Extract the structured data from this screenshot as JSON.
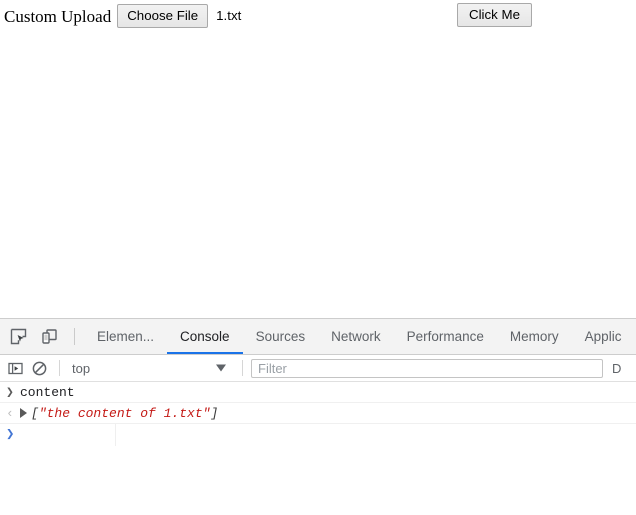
{
  "page": {
    "upload_label": "Custom Upload",
    "choose_file_button": "Choose File",
    "file_name": "1.txt",
    "click_me_button": "Click Me"
  },
  "devtools": {
    "icons": {
      "inspect": "inspect-element-icon",
      "device": "device-toolbar-icon",
      "sidebar": "console-sidebar-icon",
      "clear": "clear-console-icon"
    },
    "tabs": [
      {
        "label": "Elemen...",
        "active": false
      },
      {
        "label": "Console",
        "active": true
      },
      {
        "label": "Sources",
        "active": false
      },
      {
        "label": "Network",
        "active": false
      },
      {
        "label": "Performance",
        "active": false
      },
      {
        "label": "Memory",
        "active": false
      },
      {
        "label": "Applic",
        "active": false
      }
    ],
    "filterbar": {
      "context": "top",
      "filter_value": "",
      "filter_placeholder": "Filter",
      "levels_label": "D"
    },
    "console": {
      "messages": [
        {
          "kind": "input",
          "gutter": "❯",
          "text": "content"
        },
        {
          "kind": "output",
          "gutter": "‹",
          "open_bracket": "[",
          "string": "\"the content of 1.txt\"",
          "close_bracket": "]"
        }
      ],
      "prompt": "❯"
    }
  },
  "colors": {
    "accent_blue": "#1a73e8",
    "prompt_blue": "#4275d4",
    "string_red": "#c41a16",
    "toolbar_bg": "#f3f3f3"
  }
}
